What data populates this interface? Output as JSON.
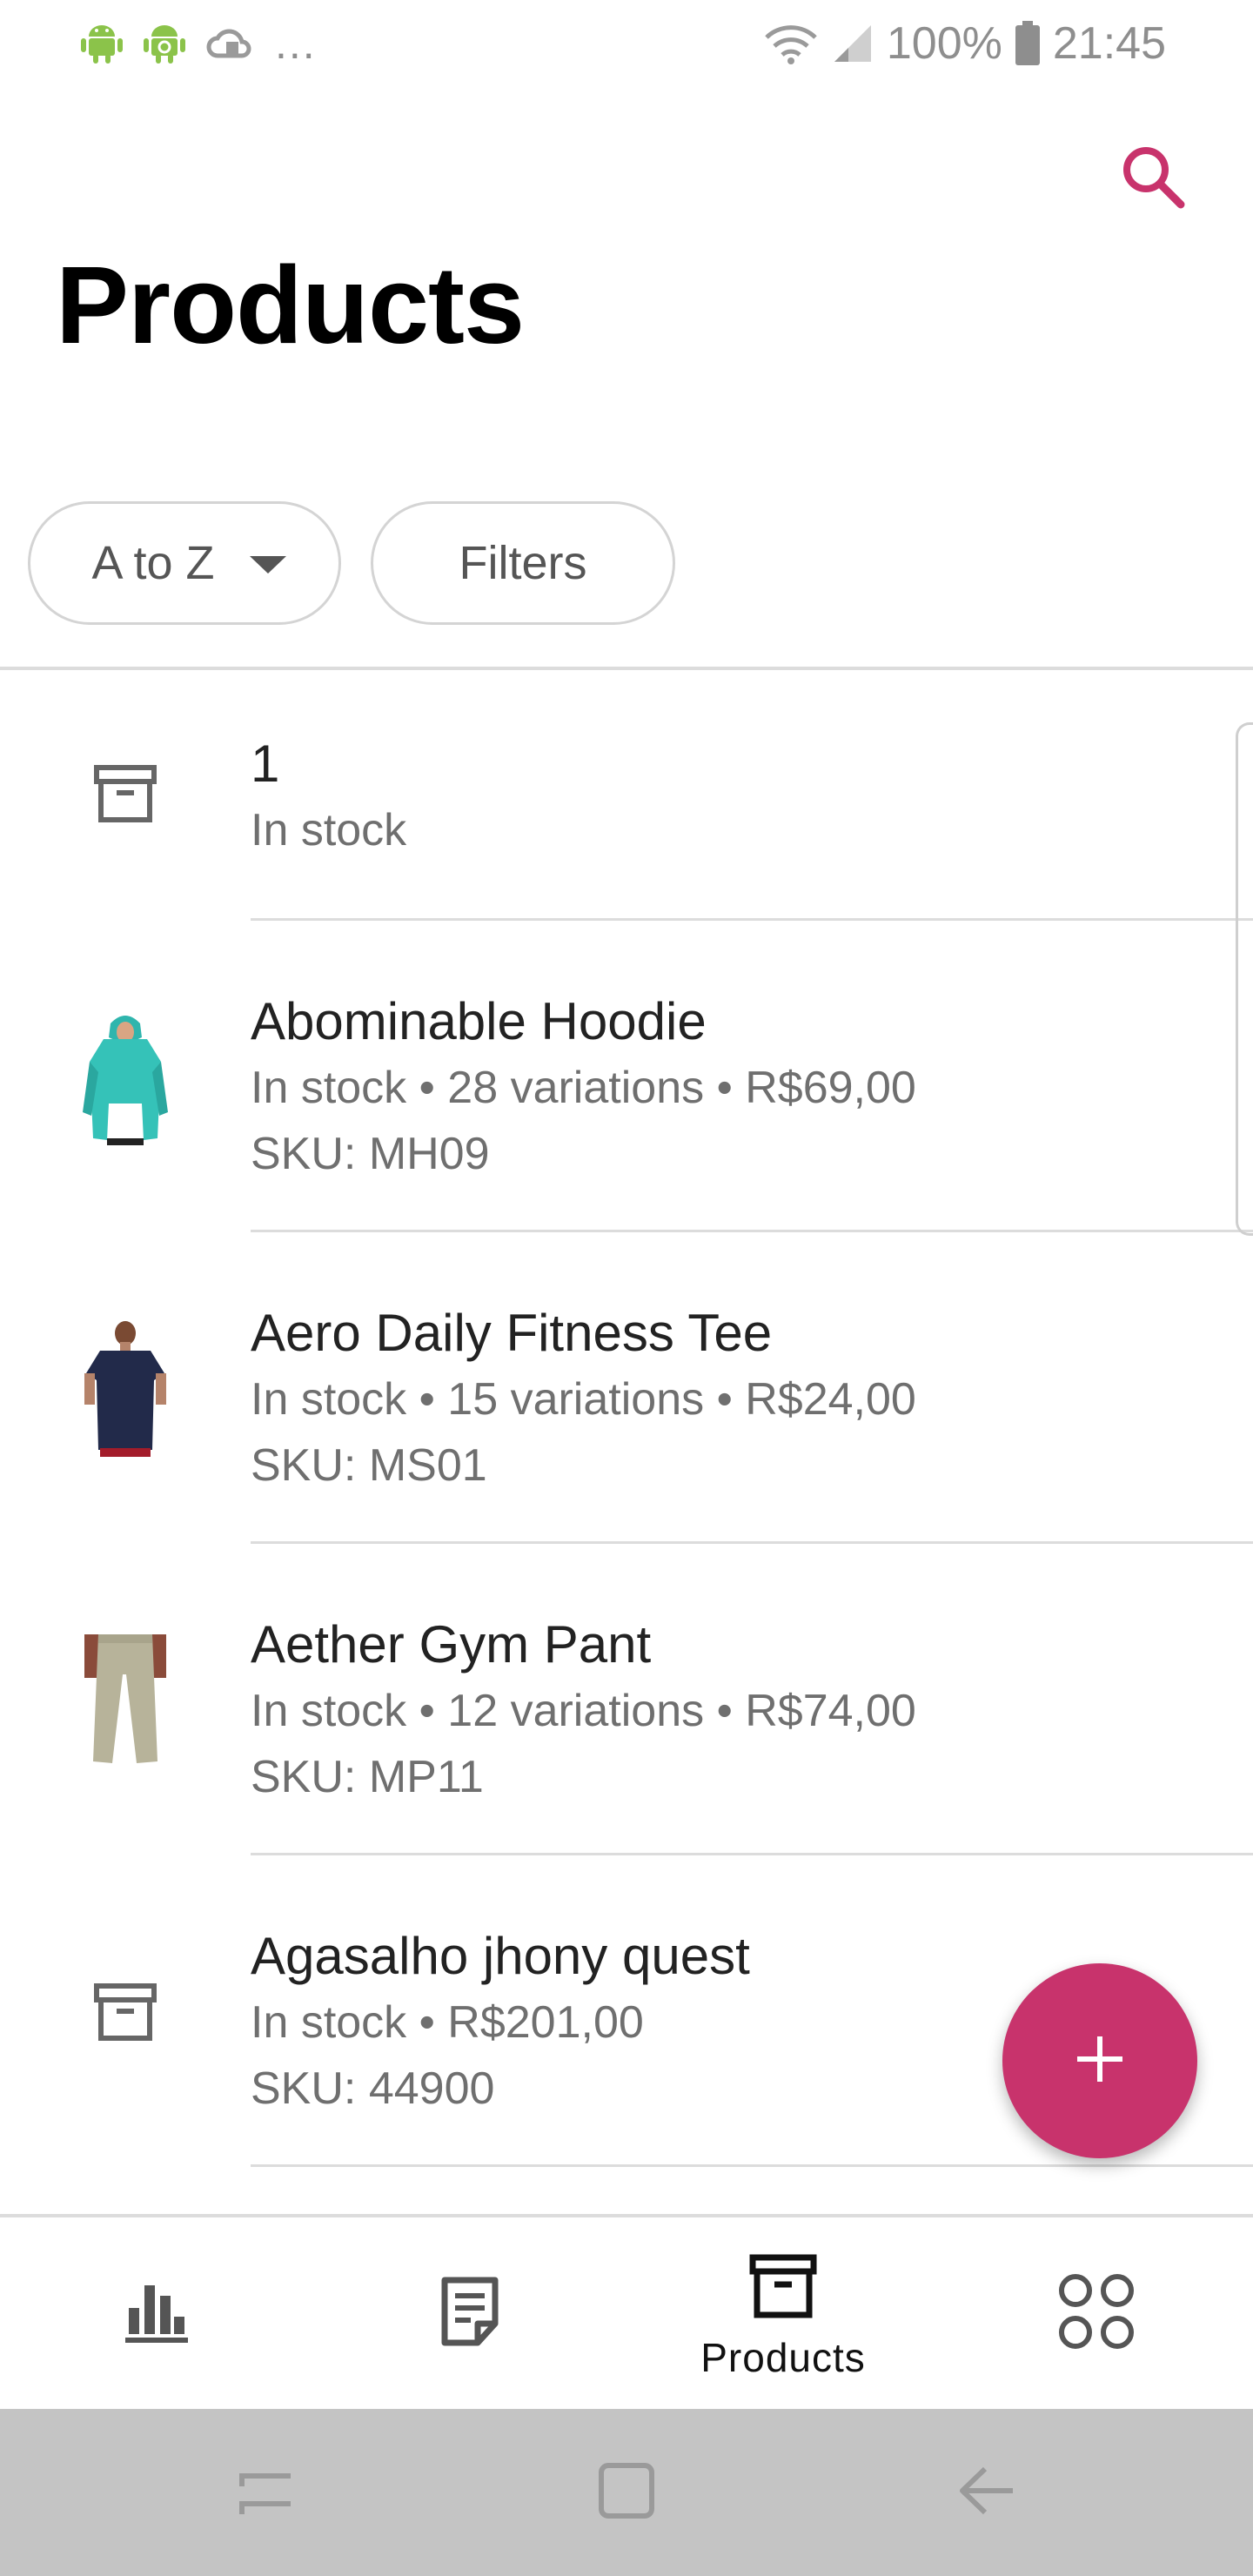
{
  "status_bar": {
    "overflow": "...",
    "battery": "100%",
    "time": "21:45",
    "icons": [
      "android-icon",
      "android-debug-icon",
      "cloud-sync-icon",
      "wifi-icon",
      "signal-icon",
      "battery-icon"
    ]
  },
  "header": {
    "title": "Products",
    "search_icon": "search-icon"
  },
  "filters": {
    "sort_label": "A to Z",
    "filters_label": "Filters"
  },
  "products": [
    {
      "name": "1",
      "meta": "In stock",
      "sku": "",
      "thumb": "archive-icon"
    },
    {
      "name": "Abominable Hoodie",
      "meta": "In stock • 28 variations • R$69,00",
      "sku": "SKU: MH09",
      "thumb": "hoodie-photo"
    },
    {
      "name": "Aero Daily Fitness Tee",
      "meta": "In stock • 15 variations • R$24,00",
      "sku": "SKU: MS01",
      "thumb": "tshirt-photo"
    },
    {
      "name": "Aether Gym Pant",
      "meta": "In stock • 12 variations • R$74,00",
      "sku": "SKU: MP11",
      "thumb": "pants-photo"
    },
    {
      "name": "Agasalho jhony quest",
      "meta": "In stock • R$201,00",
      "sku": "SKU: 44900",
      "thumb": "archive-icon"
    }
  ],
  "fab": {
    "icon": "plus-icon"
  },
  "bottom_nav": {
    "items": [
      {
        "id": "stats",
        "icon": "bar-chart-icon",
        "label": ""
      },
      {
        "id": "orders",
        "icon": "document-icon",
        "label": ""
      },
      {
        "id": "products",
        "icon": "archive-icon",
        "label": "Products"
      },
      {
        "id": "more",
        "icon": "grid-icon",
        "label": ""
      }
    ],
    "active": "products"
  },
  "system_nav": [
    "recent-apps-icon",
    "home-icon",
    "back-icon"
  ],
  "colors": {
    "accent": "#c8336c",
    "text_primary": "#222222",
    "text_secondary": "#6f6f6f",
    "divider": "#dcdcdc",
    "system_nav_bg": "#c4c4c4",
    "android_green": "#8bc34a"
  }
}
